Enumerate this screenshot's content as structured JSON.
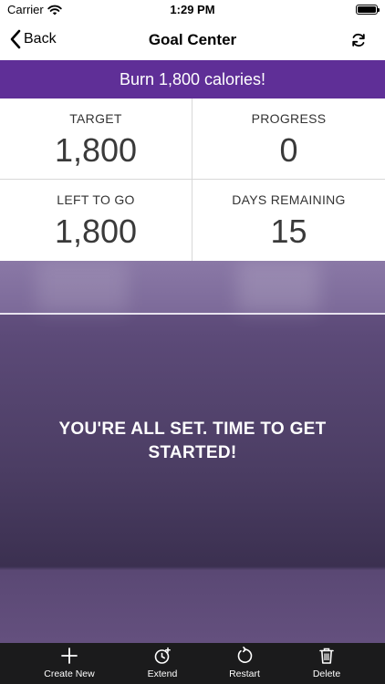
{
  "status": {
    "carrier": "Carrier",
    "time": "1:29 PM",
    "battery_level": 1.0
  },
  "nav": {
    "back_label": "Back",
    "title": "Goal Center"
  },
  "banner": {
    "text": "Burn 1,800 calories!"
  },
  "stats": [
    {
      "label": "TARGET",
      "value": "1,800"
    },
    {
      "label": "PROGRESS",
      "value": "0"
    },
    {
      "label": "LEFT TO GO",
      "value": "1,800"
    },
    {
      "label": "DAYS REMAINING",
      "value": "15"
    }
  ],
  "hero": {
    "message": "YOU'RE ALL SET. TIME TO GET STARTED!"
  },
  "toolbar": {
    "items": [
      {
        "label": "Create New",
        "icon": "plus-icon"
      },
      {
        "label": "Extend",
        "icon": "clock-plus-icon"
      },
      {
        "label": "Restart",
        "icon": "restart-icon"
      },
      {
        "label": "Delete",
        "icon": "trash-icon"
      }
    ]
  },
  "colors": {
    "banner": "#5f2f97",
    "toolbar": "#1b1b1c",
    "hero": "#4b3d63"
  }
}
